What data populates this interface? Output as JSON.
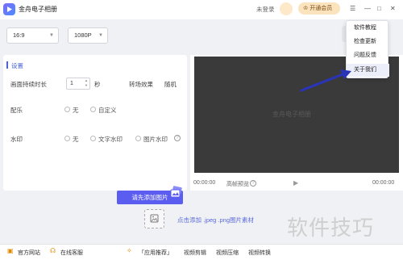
{
  "titlebar": {
    "app_title": "金舟电子相册",
    "login_text": "未登录",
    "vip_label": "开通会员",
    "window_icons": [
      "menu-icon",
      "minimize-icon",
      "maximize-icon",
      "close-icon"
    ]
  },
  "toolbar": {
    "ratio_value": "16:9",
    "resolution_value": "1080P"
  },
  "settings": {
    "title": "设置",
    "duration_label": "画面持续时长",
    "duration_value": "1",
    "duration_unit": "秒",
    "transition_label": "转场效果",
    "transition_value": "随机",
    "music_label": "配乐",
    "music_opt_none": "无",
    "music_opt_custom": "自定义",
    "watermark_label": "水印",
    "wm_opt_none": "无",
    "wm_opt_text": "文字水印",
    "wm_opt_image": "图片水印"
  },
  "preview": {
    "watermark_text": "金舟电子相册",
    "time_start": "00:00:00",
    "hd_label": "高帧预览",
    "time_end": "00:00:00"
  },
  "upload": {
    "tip": "请先添加图片",
    "hint": "点击添加 .jpeg .png图片素材"
  },
  "footer": {
    "website": "官方网站",
    "service": "在线客服",
    "recommend": "「应用推荐」",
    "apps": [
      "视频剪辑",
      "视频压缩",
      "视频转换"
    ]
  },
  "menu": {
    "items": [
      "软件教程",
      "检查更新",
      "问题反馈",
      "关于我们"
    ],
    "hovered_index": 3
  },
  "overlay_watermark": "软件技巧",
  "colors": {
    "accent": "#5b5cf0",
    "vip": "#fbe3bd",
    "arrow": "#2a34b8"
  }
}
